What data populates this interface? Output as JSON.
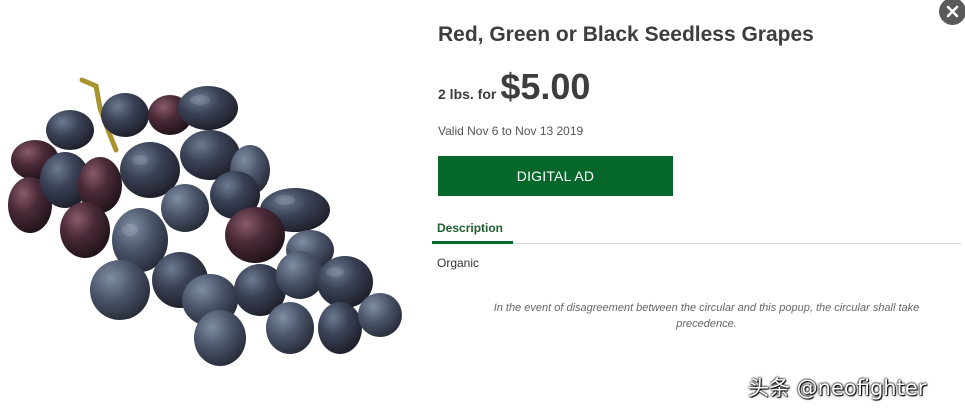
{
  "product": {
    "title": "Red, Green or Black Seedless Grapes",
    "quantity": "2 lbs. for",
    "price": "$5.00",
    "validity": "Valid Nov 6 to Nov 13 2019",
    "image_icon": "grapes-image"
  },
  "actions": {
    "digital_ad_label": "DIGITAL AD",
    "close_icon": "close-icon"
  },
  "tabs": [
    {
      "label": "Description",
      "active": true
    }
  ],
  "description": {
    "text": "Organic",
    "disclaimer": "In the event of disagreement between the circular and this popup, the circular shall take precedence."
  },
  "watermark": {
    "text": "头条 @neofighter"
  },
  "colors": {
    "accent_green": "#05682a",
    "title_text": "#3d3d3d",
    "close_bg": "#5a5a5a"
  }
}
